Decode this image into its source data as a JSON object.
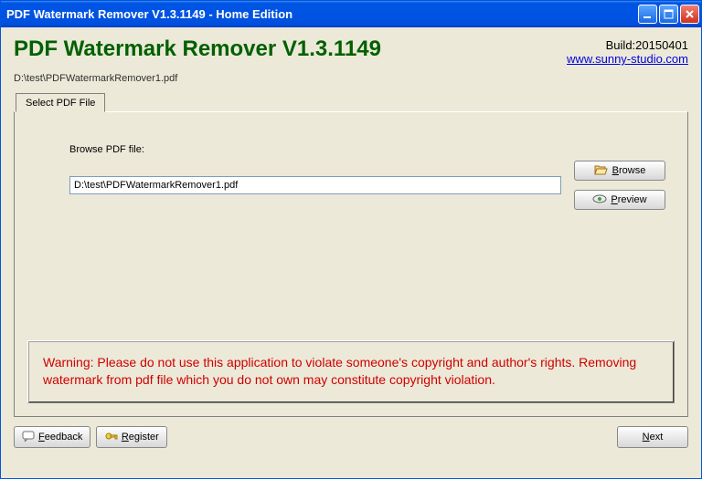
{
  "window": {
    "title": "PDF Watermark Remover V1.3.1149 - Home Edition"
  },
  "header": {
    "app_title": "PDF Watermark Remover V1.3.1149",
    "build": "Build:20150401",
    "website": "www.sunny-studio.com"
  },
  "file_path_display": "D:\\test\\PDFWatermarkRemover1.pdf",
  "tab": {
    "label": "Select PDF File"
  },
  "form": {
    "browse_label": "Browse PDF file:",
    "file_value": "D:\\test\\PDFWatermarkRemover1.pdf",
    "browse_btn": "Browse",
    "preview_btn": "Preview"
  },
  "warning": "Warning: Please do not use this application to violate someone's copyright and author's rights. Removing watermark from pdf file which you do not own may constitute copyright violation.",
  "footer": {
    "feedback": "Feedback",
    "register": "Register",
    "next": "Next"
  }
}
